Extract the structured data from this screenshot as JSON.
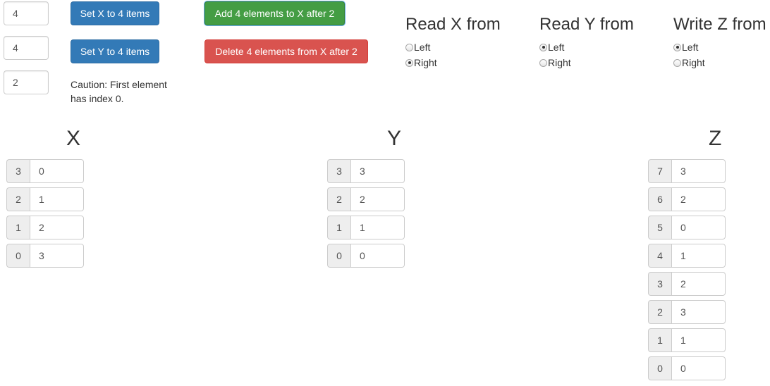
{
  "inputs": {
    "x_count": "4",
    "y_count": "4",
    "position": "2"
  },
  "buttons": {
    "set_x": "Set X to 4 items",
    "set_y": "Set Y to 4 items",
    "add": "Add 4 elements to X after 2",
    "delete": "Delete 4 elements from X after 2"
  },
  "caution": "Caution: First element has index 0.",
  "radios": {
    "read_x": {
      "title": "Read X from",
      "left": "Left",
      "right": "Right",
      "selected": "Right"
    },
    "read_y": {
      "title": "Read Y from",
      "left": "Left",
      "right": "Right",
      "selected": "Left"
    },
    "write_z": {
      "title": "Write Z from",
      "left": "Left",
      "right": "Right",
      "selected": "Left"
    }
  },
  "columns": {
    "x": {
      "title": "X",
      "rows": [
        {
          "index": "3",
          "value": "0"
        },
        {
          "index": "2",
          "value": "1"
        },
        {
          "index": "1",
          "value": "2"
        },
        {
          "index": "0",
          "value": "3"
        }
      ]
    },
    "y": {
      "title": "Y",
      "rows": [
        {
          "index": "3",
          "value": "3"
        },
        {
          "index": "2",
          "value": "2"
        },
        {
          "index": "1",
          "value": "1"
        },
        {
          "index": "0",
          "value": "0"
        }
      ]
    },
    "z": {
      "title": "Z",
      "rows": [
        {
          "index": "7",
          "value": "3"
        },
        {
          "index": "6",
          "value": "2"
        },
        {
          "index": "5",
          "value": "0"
        },
        {
          "index": "4",
          "value": "1"
        },
        {
          "index": "3",
          "value": "2"
        },
        {
          "index": "2",
          "value": "3"
        },
        {
          "index": "1",
          "value": "1"
        },
        {
          "index": "0",
          "value": "0"
        }
      ]
    }
  },
  "colors": {
    "primary": "#337ab7",
    "success": "#5cb85c",
    "danger": "#d9534f"
  }
}
